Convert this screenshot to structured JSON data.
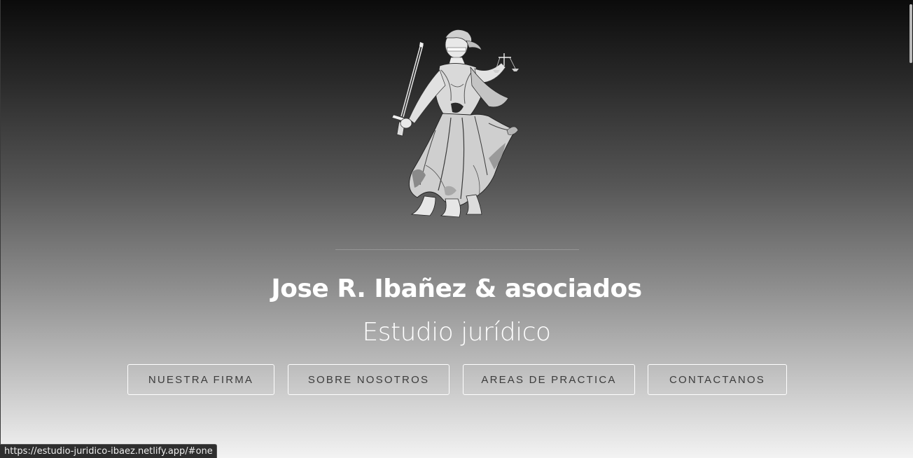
{
  "header": {
    "logo_icon": "lady-justice-engraving",
    "title": "Jose R. Ibañez & asociados",
    "subtitle": "Estudio jurídico"
  },
  "nav": {
    "items": [
      {
        "label": "NUESTRA FIRMA"
      },
      {
        "label": "SOBRE NOSOTROS"
      },
      {
        "label": "AREAS DE PRACTICA"
      },
      {
        "label": "CONTACTANOS"
      }
    ]
  },
  "status_bar": {
    "url": "https://estudio-juridico-ibaez.netlify.app/#one"
  },
  "colors": {
    "title_text": "#ffffff",
    "button_border": "#ffffff",
    "button_text": "#3c3c3c",
    "gradient_top": "#0b0b0b",
    "gradient_bottom": "#f3f3f3"
  }
}
